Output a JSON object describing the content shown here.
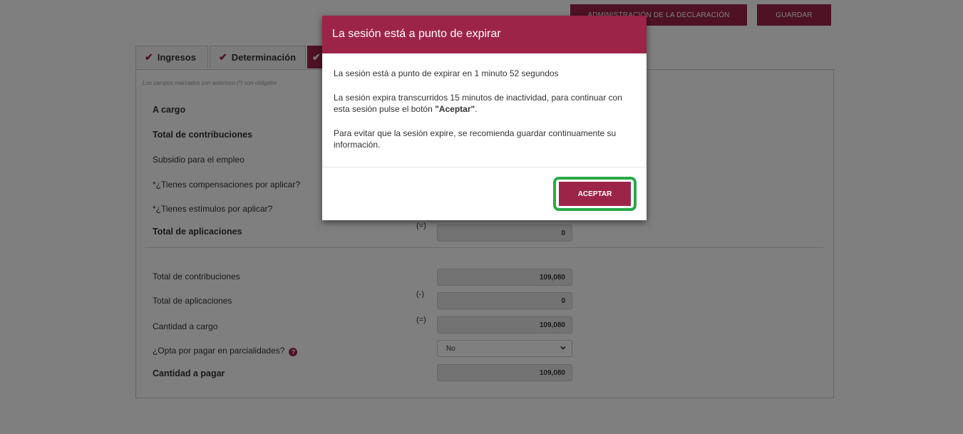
{
  "header": {
    "admin_label": "ADMINISTRACIÓN DE LA DECLARACIÓN",
    "save_label": "GUARDAR"
  },
  "tabs": [
    {
      "label": "Ingresos"
    },
    {
      "label": "Determinación"
    }
  ],
  "form": {
    "note": "Los campos marcados con asterisco (*) son obligator",
    "section_a": "A cargo",
    "total_contribuciones": "Total de contribuciones",
    "subsidio": "Subsidio para el empleo",
    "compensaciones": "*¿Tienes compensaciones por aplicar?",
    "estimulos": "*¿Tienes estímulos por aplicar?",
    "total_aplicaciones": "Total de aplicaciones",
    "total_aplicaciones_op": "(=)",
    "total_aplicaciones_value": "0",
    "summary": {
      "contribuciones_label": "Total de contribuciones",
      "contribuciones_value": "109,080",
      "aplicaciones_label": "Total de aplicaciones",
      "aplicaciones_op": "(-)",
      "aplicaciones_value": "0",
      "cantidad_cargo_label": "Cantidad a cargo",
      "cantidad_cargo_op": "(=)",
      "cantidad_cargo_value": "109,080",
      "parcialidades_label": "¿Opta por pagar en parcialidades?",
      "parcialidades_value": "No",
      "cantidad_pagar_label": "Cantidad a pagar",
      "cantidad_pagar_value": "109,080"
    }
  },
  "modal": {
    "title": "La sesión está a punto de expirar",
    "line1": "La sesión está a punto de expirar en 1 minuto 52 segundos",
    "line2_prefix": "La sesión expira transcurridos 15 minutos de inactividad, para continuar con esta sesión pulse el botón ",
    "line2_bold": "\"Aceptar\"",
    "line2_suffix": ".",
    "line3": "Para evitar que la sesión expire, se recomienda guardar continuamente su información.",
    "accept_label": "ACEPTAR"
  },
  "colors": {
    "brand": "#9d2449",
    "highlight": "#2aa84a"
  }
}
